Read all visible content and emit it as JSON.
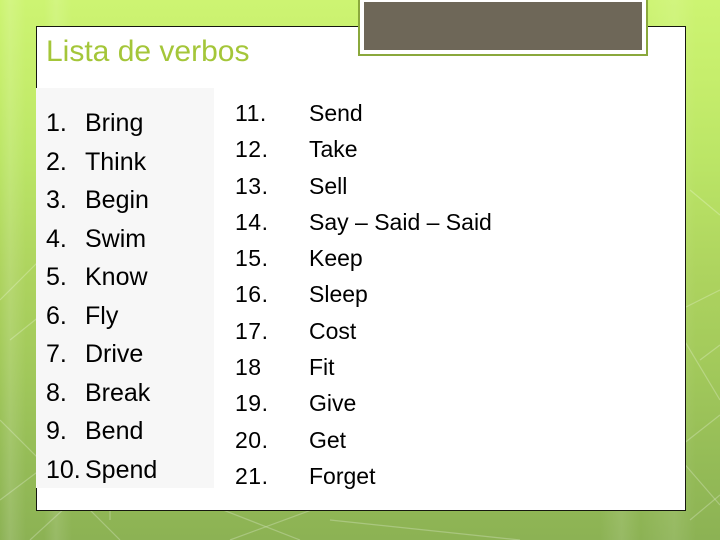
{
  "slide": {
    "title": "Lista de verbos",
    "title_color": "#a4c639",
    "background_color_top": "#cdf472",
    "background_color_bottom": "#8cb254",
    "card_background": "#ffffff",
    "card_border_color": "#15170f"
  },
  "picture_placeholder": {
    "name": "image-placeholder",
    "fill_color": "#6e6758",
    "frame_color": "#8aa83c"
  },
  "left_column": {
    "panel_background": "#f7f7f7",
    "items": [
      {
        "num": "1.",
        "word": "Bring"
      },
      {
        "num": "2.",
        "word": "Think"
      },
      {
        "num": "3.",
        "word": "Begin"
      },
      {
        "num": "4.",
        "word": "Swim"
      },
      {
        "num": "5.",
        "word": "Know"
      },
      {
        "num": "6.",
        "word": "Fly"
      },
      {
        "num": "7.",
        "word": "Drive"
      },
      {
        "num": "8.",
        "word": "Break"
      },
      {
        "num": "9.",
        "word": "Bend"
      },
      {
        "num": "10.",
        "word": "Spend"
      }
    ]
  },
  "right_column": {
    "items": [
      {
        "num": "11.",
        "word": "Send"
      },
      {
        "num": "12.",
        "word": "Take"
      },
      {
        "num": "13.",
        "word": "Sell"
      },
      {
        "num": "14.",
        "word": "Say – Said – Said"
      },
      {
        "num": "15.",
        "word": "Keep"
      },
      {
        "num": "16.",
        "word": "Sleep"
      },
      {
        "num": "17.",
        "word": "Cost"
      },
      {
        "num": "18",
        "word": "Fit"
      },
      {
        "num": "19.",
        "word": "Give"
      },
      {
        "num": "20.",
        "word": "Get"
      },
      {
        "num": "21.",
        "word": "Forget"
      }
    ]
  }
}
